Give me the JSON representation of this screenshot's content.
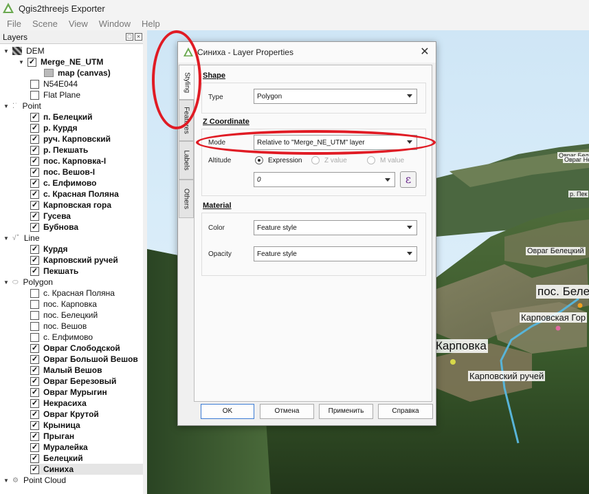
{
  "app": {
    "title": "Qgis2threejs Exporter"
  },
  "menu": [
    "File",
    "Scene",
    "View",
    "Window",
    "Help"
  ],
  "layers_panel": {
    "title": "Layers"
  },
  "layers": [
    {
      "label": "DEM",
      "kind": "group",
      "icon": "dem-icon"
    },
    {
      "label": "Merge_NE_UTM",
      "checked": true,
      "bold": true,
      "expander": true
    },
    {
      "label": "map (canvas)",
      "bold": true,
      "icon": "map-icon"
    },
    {
      "label": "N54E044",
      "checked": false
    },
    {
      "label": "Flat Plane",
      "checked": false
    },
    {
      "label": "Point",
      "kind": "group",
      "icon": "point-icon"
    },
    {
      "label": "п. Белецкий",
      "checked": true,
      "bold": true
    },
    {
      "label": "р. Курдя",
      "checked": true,
      "bold": true
    },
    {
      "label": "руч. Карповский",
      "checked": true,
      "bold": true
    },
    {
      "label": "р. Пекшать",
      "checked": true,
      "bold": true
    },
    {
      "label": "пос. Карповка-I",
      "checked": true,
      "bold": true
    },
    {
      "label": "пос. Вешов-I",
      "checked": true,
      "bold": true
    },
    {
      "label": "с. Елфимово",
      "checked": true,
      "bold": true
    },
    {
      "label": "с. Красная Поляна",
      "checked": true,
      "bold": true
    },
    {
      "label": "Карповская гора",
      "checked": true,
      "bold": true
    },
    {
      "label": "Гусева",
      "checked": true,
      "bold": true
    },
    {
      "label": "Бубнова",
      "checked": true,
      "bold": true
    },
    {
      "label": "Line",
      "kind": "group",
      "icon": "line-icon"
    },
    {
      "label": "Курдя",
      "checked": true,
      "bold": true
    },
    {
      "label": "Карповский ручей",
      "checked": true,
      "bold": true
    },
    {
      "label": "Пекшать",
      "checked": true,
      "bold": true
    },
    {
      "label": "Polygon",
      "kind": "group",
      "icon": "polygon-icon"
    },
    {
      "label": "с. Красная Поляна",
      "checked": false
    },
    {
      "label": "пос. Карповка",
      "checked": false
    },
    {
      "label": "пос. Белецкий",
      "checked": false
    },
    {
      "label": "пос. Вешов",
      "checked": false
    },
    {
      "label": "с. Елфимово",
      "checked": false
    },
    {
      "label": "Овраг Слободской",
      "checked": true,
      "bold": true
    },
    {
      "label": "Овраг Большой Вешов",
      "checked": true,
      "bold": true
    },
    {
      "label": "Малый Вешов",
      "checked": true,
      "bold": true
    },
    {
      "label": "Овраг Березовый",
      "checked": true,
      "bold": true
    },
    {
      "label": "Овраг Мурыгин",
      "checked": true,
      "bold": true
    },
    {
      "label": "Некрасиха",
      "checked": true,
      "bold": true
    },
    {
      "label": "Овраг Крутой",
      "checked": true,
      "bold": true
    },
    {
      "label": "Крыница",
      "checked": true,
      "bold": true
    },
    {
      "label": "Прыган",
      "checked": true,
      "bold": true
    },
    {
      "label": "Муралейка",
      "checked": true,
      "bold": true
    },
    {
      "label": "Белецкий",
      "checked": true,
      "bold": true
    },
    {
      "label": "Синиха",
      "checked": true,
      "bold": true,
      "selected": true
    },
    {
      "label": "Point Cloud",
      "kind": "group",
      "icon": "point-cloud-icon"
    }
  ],
  "scene_labels": {
    "karpovka": "Карповка",
    "karpovsky_ruchey": "Карповский ручей",
    "karpovskaya_gora": "Карповская Гор",
    "pos_bel": "пос. Беле",
    "ovrag_beletsky": "Овраг Белецкий",
    "ovrag_bel_top": "Овраг Бел",
    "r_pek": "р. Пек",
    "ovrag_top_right": "Овраг Неч"
  },
  "dialog": {
    "title": "Синиха - Layer Properties",
    "close": "✕",
    "tabs": [
      "Styling",
      "Features",
      "Labels",
      "Others"
    ],
    "shape_section": "Shape",
    "type_label": "Type",
    "type_value": "Polygon",
    "z_section": "Z Coordinate",
    "mode_label": "Mode",
    "mode_value": "Relative to \"Merge_NE_UTM\" layer",
    "altitude_label": "Altitude",
    "radio_expression": "Expression",
    "radio_z": "Z value",
    "radio_m": "M value",
    "expression_value": "0",
    "expression_btn": "ε",
    "material_section": "Material",
    "color_label": "Color",
    "color_value": "Feature style",
    "opacity_label": "Opacity",
    "opacity_value": "Feature style",
    "buttons": {
      "ok": "OK",
      "cancel": "Отмена",
      "apply": "Применить",
      "help": "Справка"
    }
  },
  "colors": {
    "annotation_red": "#e01b24",
    "accent_blue": "#3b7bd4"
  }
}
